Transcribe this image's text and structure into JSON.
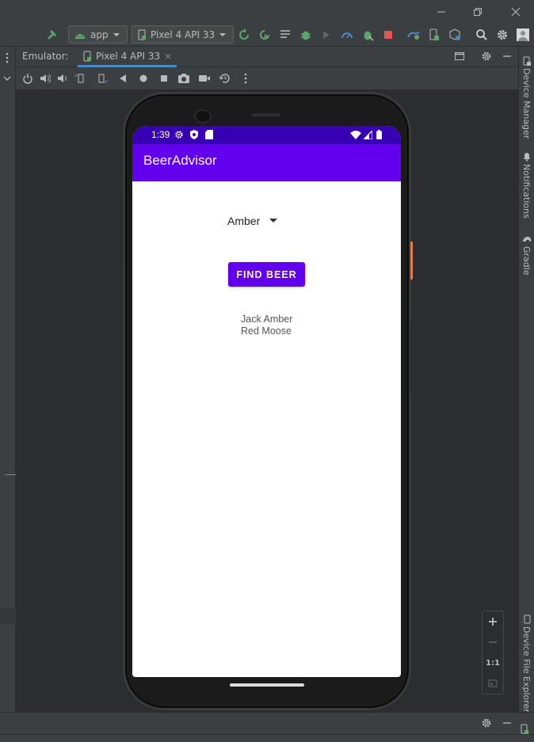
{
  "toolbar": {
    "run_config": "app",
    "device": "Pixel 4 API 33"
  },
  "emulator": {
    "label": "Emulator:",
    "tab": "Pixel 4 API 33"
  },
  "right_panels": [
    "Device Manager",
    "Notifications",
    "Gradle",
    "Device File Explorer"
  ],
  "phone": {
    "time": "1:39",
    "app_title": "BeerAdvisor",
    "spinner_value": "Amber",
    "button_label": "FIND BEER",
    "results": [
      "Jack Amber",
      "Red Moose"
    ]
  },
  "zoom": {
    "one_to_one": "1:1"
  },
  "colors": {
    "primary": "#6200ee",
    "primary_dark": "#3700b3",
    "ide_bg": "#2b2d30",
    "ide_panel": "#3c3f41",
    "run_green": "#59a869",
    "stop_red": "#e05555",
    "tab_underline": "#4a88c7"
  }
}
